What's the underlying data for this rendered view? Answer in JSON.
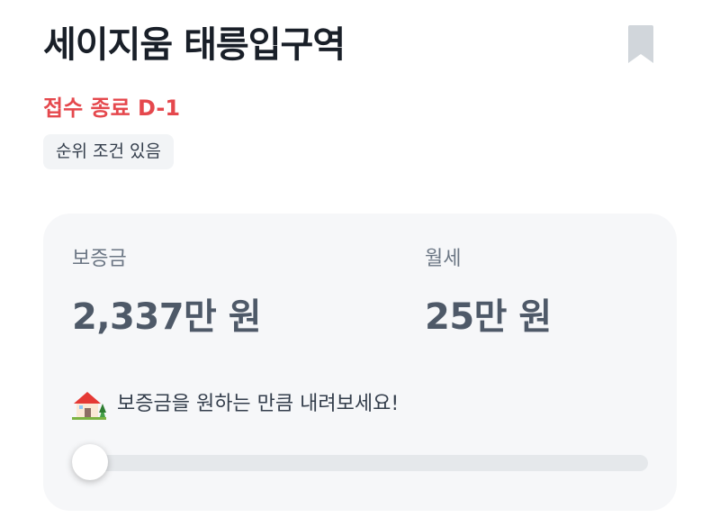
{
  "listing": {
    "title": "세이지움 태릉입구역",
    "deadline": "접수 종료 D-1",
    "tag": "순위 조건 있음"
  },
  "price": {
    "deposit_label": "보증금",
    "deposit_value": "2,337만 원",
    "rent_label": "월세",
    "rent_value": "25만 원",
    "hint": "보증금을 원하는 만큼 내려보세요!"
  },
  "slider": {
    "level": 0
  },
  "colors": {
    "deadline": "#e5484d",
    "bookmark": "#d1d6db",
    "card_bg": "#f6f7f9"
  },
  "icons": {
    "bookmark": "bookmark-icon",
    "hint": "house-icon"
  }
}
